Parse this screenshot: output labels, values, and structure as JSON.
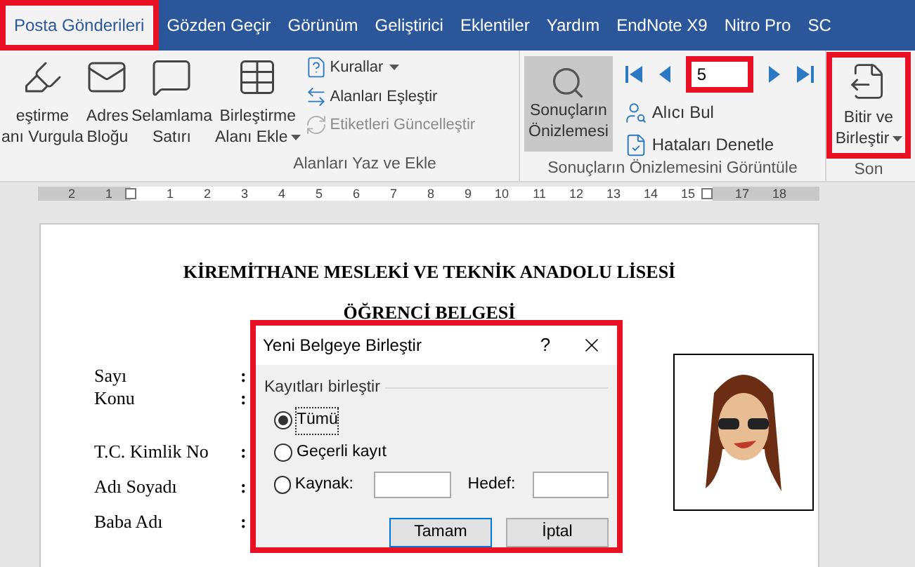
{
  "tabs": [
    {
      "label": "Posta Gönderileri",
      "selected": true,
      "highlighted": true
    },
    {
      "label": "Gözden Geçir",
      "selected": false,
      "highlighted": false
    },
    {
      "label": "Görünüm",
      "selected": false,
      "highlighted": false
    },
    {
      "label": "Geliştirici",
      "selected": false,
      "highlighted": false
    },
    {
      "label": "Eklentiler",
      "selected": false,
      "highlighted": false
    },
    {
      "label": "Yardım",
      "selected": false,
      "highlighted": false
    },
    {
      "label": "EndNote X9",
      "selected": false,
      "highlighted": false
    },
    {
      "label": "Nitro Pro",
      "selected": false,
      "highlighted": false
    },
    {
      "label": "SC",
      "selected": false,
      "highlighted": false
    }
  ],
  "ribbon": {
    "write_group": {
      "label": "Alanları Yaz ve Ekle",
      "large_buttons": [
        {
          "lines": [
            "eştirme",
            "anı Vurgula"
          ],
          "kind": "highlight",
          "has_menu": false
        },
        {
          "lines": [
            "Adres",
            "Bloğu"
          ],
          "kind": "address",
          "has_menu": false
        },
        {
          "lines": [
            "Selamlama",
            "Satırı"
          ],
          "kind": "greeting",
          "has_menu": false
        },
        {
          "lines": [
            "Birleştirme",
            "Alanı Ekle"
          ],
          "kind": "field",
          "has_menu": true
        }
      ],
      "small_buttons": [
        {
          "label": "Kurallar",
          "kind": "rules",
          "has_menu": true,
          "disabled": false
        },
        {
          "label": "Alanları Eşleştir",
          "kind": "match",
          "has_menu": false,
          "disabled": false
        },
        {
          "label": "Etiketleri Güncelleştir",
          "kind": "update",
          "has_menu": false,
          "disabled": true
        }
      ]
    },
    "preview_group": {
      "label": "Sonuçların Önizlemesini Görüntüle",
      "preview_button": {
        "lines": [
          "Sonuçların",
          "Önizlemesi"
        ],
        "selected": true
      },
      "record_field": {
        "value": "5",
        "highlighted": true
      },
      "small_buttons": [
        {
          "label": "Alıcı Bul",
          "kind": "find"
        },
        {
          "label": "Hataları Denetle",
          "kind": "check"
        }
      ]
    },
    "finish_group": {
      "label": "Son",
      "button": {
        "lines": [
          "Bitir ve",
          "Birleştir"
        ],
        "has_menu": true,
        "highlighted": true
      }
    }
  },
  "ruler": {
    "left_numbers": [
      "2",
      "1"
    ],
    "numbers": [
      "1",
      "2",
      "3",
      "4",
      "5",
      "6",
      "7",
      "8",
      "9",
      "10",
      "11",
      "12",
      "13",
      "14",
      "15"
    ],
    "right_numbers": [
      "17",
      "18"
    ]
  },
  "document": {
    "title": "KİREMİTHANE MESLEKİ VE TEKNİK ANADOLU LİSESİ",
    "subtitle": "ÖĞRENCİ BELGESİ",
    "fields": [
      {
        "label": "Sayı",
        "separator": ":"
      },
      {
        "label": "Konu",
        "separator": ":"
      },
      {
        "label": "T.C. Kimlik No",
        "separator": ":"
      },
      {
        "label": "Adı Soyadı",
        "separator": ":"
      },
      {
        "label": "Baba Adı",
        "separator": ":"
      }
    ]
  },
  "dialog": {
    "title": "Yeni Belgeye Birleştir",
    "help": "?",
    "highlighted": true,
    "group_label": "Kayıtları birleştir",
    "options": [
      {
        "label": "Tümü",
        "selected": true
      },
      {
        "label": "Geçerli kayıt",
        "selected": false
      },
      {
        "label": "Kaynak:",
        "selected": false
      }
    ],
    "to_label": "Hedef:",
    "buttons": [
      {
        "label": "Tamam",
        "default": true
      },
      {
        "label": "İptal",
        "default": false
      }
    ]
  }
}
